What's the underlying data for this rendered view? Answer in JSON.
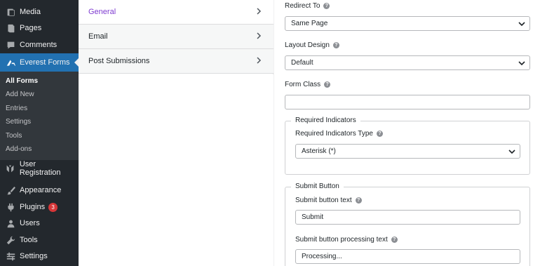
{
  "wp_menu": {
    "media": "Media",
    "pages": "Pages",
    "comments": "Comments",
    "everest_forms": "Everest Forms",
    "submenu": [
      "All Forms",
      "Add New",
      "Entries",
      "Settings",
      "Tools",
      "Add-ons"
    ],
    "user_registration": "User Registration",
    "appearance": "Appearance",
    "plugins": "Plugins",
    "plugins_badge": "3",
    "users": "Users",
    "tools": "Tools",
    "settings": "Settings"
  },
  "sections": [
    {
      "label": "General"
    },
    {
      "label": "Email"
    },
    {
      "label": "Post Submissions"
    }
  ],
  "fields": {
    "redirect_to": {
      "label": "Redirect To",
      "value": "Same Page"
    },
    "layout_design": {
      "label": "Layout Design",
      "value": "Default"
    },
    "form_class": {
      "label": "Form Class",
      "value": ""
    },
    "required_indicators": {
      "legend": "Required Indicators",
      "type_label": "Required Indicators Type",
      "type_value": "Asterisk (*)"
    },
    "submit_button": {
      "legend": "Submit Button",
      "text_label": "Submit button text",
      "text_value": "Submit",
      "processing_label": "Submit button processing text",
      "processing_value": "Processing..."
    }
  },
  "colors": {
    "active_section": "#7e3bd0",
    "wp_active": "#2271b1",
    "badge": "#d63638"
  }
}
